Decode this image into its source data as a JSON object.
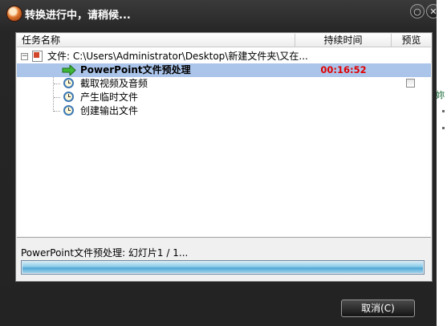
{
  "window": {
    "title": "转换进行中，请稍候...",
    "minimize_glyph": "○",
    "close_glyph": "✕"
  },
  "columns": {
    "name": "任务名称",
    "duration": "持续时间",
    "preview": "预览"
  },
  "file_row": {
    "expander": "⊟",
    "label": "文件: C:\\Users\\Administrator\\Desktop\\新建文件夹\\又在..."
  },
  "tasks": [
    {
      "label": "PowerPoint文件预处理",
      "duration": "00:16:52",
      "icon": "green-arrow-icon",
      "active": true
    },
    {
      "label": "截取视频及音频",
      "duration": "",
      "icon": "clock-icon",
      "preview_checkbox": false
    },
    {
      "label": "产生临时文件",
      "duration": "",
      "icon": "clock-icon"
    },
    {
      "label": "创建输出文件",
      "duration": "",
      "icon": "clock-icon"
    }
  ],
  "status": {
    "text": "PowerPoint文件预处理: 幻灯片1 / 1...",
    "progress": 1.0
  },
  "buttons": {
    "cancel": "取消(C)"
  },
  "background_window": {
    "text": "妳"
  },
  "colors": {
    "selected_row": "#aac4ea",
    "duration_red": "#e00000",
    "progress_blue": "#4fa7d6"
  }
}
